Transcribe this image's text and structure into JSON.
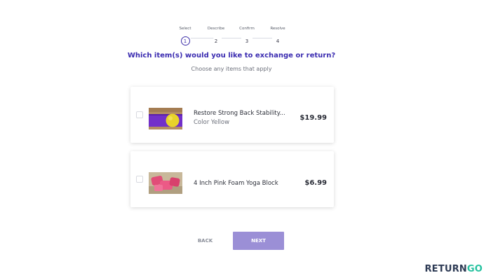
{
  "stepper": {
    "steps": [
      {
        "label": "Select",
        "number": "1",
        "active": true
      },
      {
        "label": "Describe",
        "number": "2",
        "active": false
      },
      {
        "label": "Confirm",
        "number": "3",
        "active": false
      },
      {
        "label": "Resolve",
        "number": "4",
        "active": false
      }
    ]
  },
  "heading": "Which item(s) would you like to exchange or return?",
  "subheading": "Choose any items that apply",
  "items": [
    {
      "name": "Restore Strong Back Stability...",
      "variant": "Color Yellow",
      "price": "$19.99",
      "checked": false,
      "image_icon": "yoga-ball-on-mat-image"
    },
    {
      "name": "4 Inch Pink Foam Yoga Block",
      "variant": "",
      "price": "$6.99",
      "checked": false,
      "image_icon": "pink-foam-blocks-image"
    }
  ],
  "buttons": {
    "back": "BACK",
    "next": "NEXT"
  },
  "logo": {
    "part1": "RETURN",
    "part2": "GO"
  },
  "colors": {
    "accent": "#3a2bb0",
    "next_button": "#9b8fd6",
    "logo_primary": "#2e3b55",
    "logo_secondary": "#27c2a0"
  }
}
